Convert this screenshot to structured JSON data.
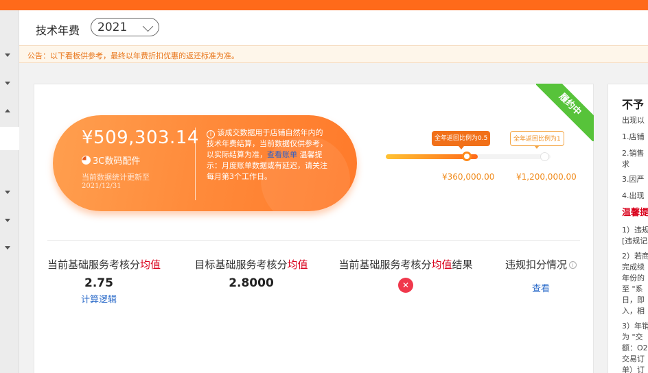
{
  "header": {
    "title": "技术年费",
    "year": "2021"
  },
  "notice": {
    "text": "公告：以下看板供参考，最终以年费折扣优惠的返还标准为准。"
  },
  "summary": {
    "amount": "¥509,303.14",
    "category": "3C数码配件",
    "updated_label": "当前数据统计更新至",
    "updated_date": "2021/12/31",
    "info_text": "该成交数据用于店铺自然年内的技术年费结算，当前数据仅供参考，以实际结算为准，",
    "info_link": "查看账单",
    "info_tip": "温馨提示：月度账单数据或有延迟，请关注每月第3个工作日。",
    "status_ribbon": "履约中"
  },
  "progress": {
    "milestones": [
      {
        "label": "全年返回比例为0.5",
        "amount": "¥360,000.00"
      },
      {
        "label": "全年返回比例为1",
        "amount": "¥1,200,000.00"
      }
    ],
    "fill_fraction": 0.56
  },
  "stats": {
    "current_score": {
      "label_prefix": "当前基础服务考核分",
      "label_highlight": "均值",
      "value": "2.75",
      "link": "计算逻辑"
    },
    "target_score": {
      "label_prefix": "目标基础服务考核分",
      "label_highlight": "均值",
      "value": "2.8000"
    },
    "result": {
      "label_prefix": "当前基础服务考核分",
      "label_highlight": "均值",
      "label_suffix": "结果",
      "status_icon": "x-circle-icon",
      "status": "failed"
    },
    "violation": {
      "label": "违规扣分情况",
      "link": "查看"
    }
  },
  "right_panel": {
    "title": "不予",
    "lines": [
      "出现以",
      "1.店铺",
      "2.销售",
      "求",
      "3.因严",
      "4.出现"
    ],
    "warning_title": "温馨提",
    "notes": [
      "1）违规",
      "[违规记",
      "2）若商",
      "完成续",
      "年份的",
      "至 \"系",
      "日，即",
      "入，相",
      "3）年销",
      "为 \"交",
      "额：O2",
      "交易订",
      "单）订"
    ]
  },
  "colors": {
    "accent": "#ff6a1a",
    "ribbon": "#57c33a",
    "highlight": "#d9001b",
    "link": "#2a6ac9"
  }
}
